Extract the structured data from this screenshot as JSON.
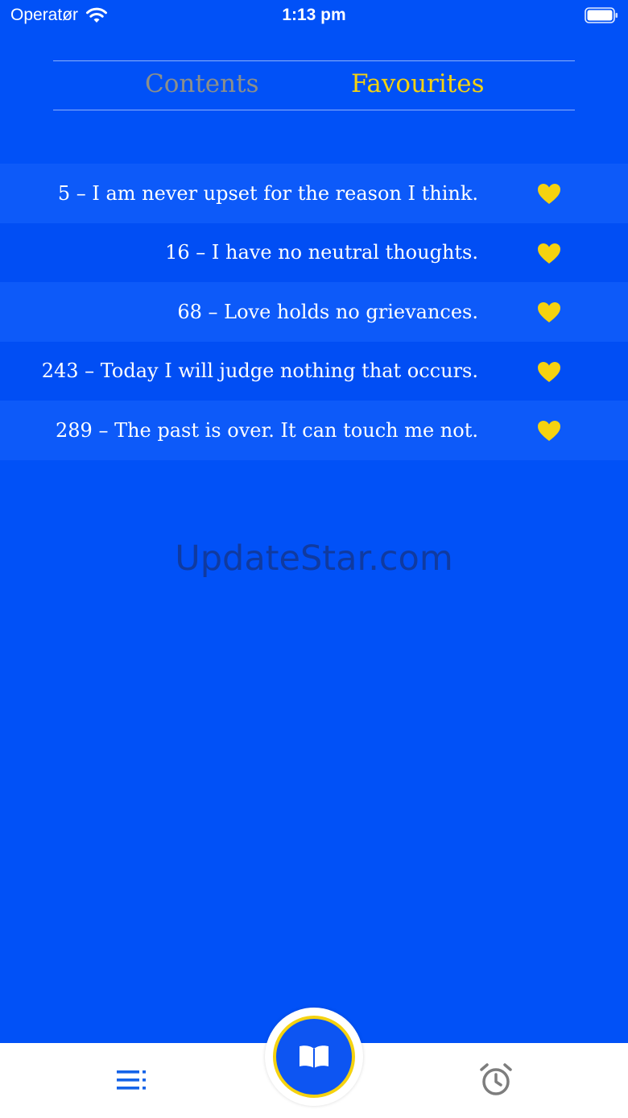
{
  "status_bar": {
    "carrier": "Operatør",
    "time": "1:13 pm",
    "wifi_icon": "wifi-icon",
    "battery_icon": "battery-icon"
  },
  "segments": {
    "contents_label": "Contents",
    "favourites_label": "Favourites",
    "selected": "Favourites"
  },
  "favourites": [
    {
      "text": "5 – I am never upset for the reason I think.",
      "icon": "heart-icon"
    },
    {
      "text": "16 – I have no neutral thoughts.",
      "icon": "heart-icon"
    },
    {
      "text": "68 – Love holds no grievances.",
      "icon": "heart-icon"
    },
    {
      "text": "243 – Today I will judge nothing that occurs.",
      "icon": "heart-icon"
    },
    {
      "text": "289 – The past is over. It can touch me not.",
      "icon": "heart-icon"
    }
  ],
  "watermark": "UpdateStar.com",
  "tab_bar": {
    "left_icon": "list-icon",
    "center_icon": "open-book-icon",
    "right_icon": "alarm-clock-icon"
  },
  "colors": {
    "background": "#0151f7",
    "accent_yellow": "#f5d20f",
    "inactive_gray": "#8c8f8a",
    "list_icon_blue": "#1463e8",
    "alarm_gray": "#7d7d7d"
  }
}
